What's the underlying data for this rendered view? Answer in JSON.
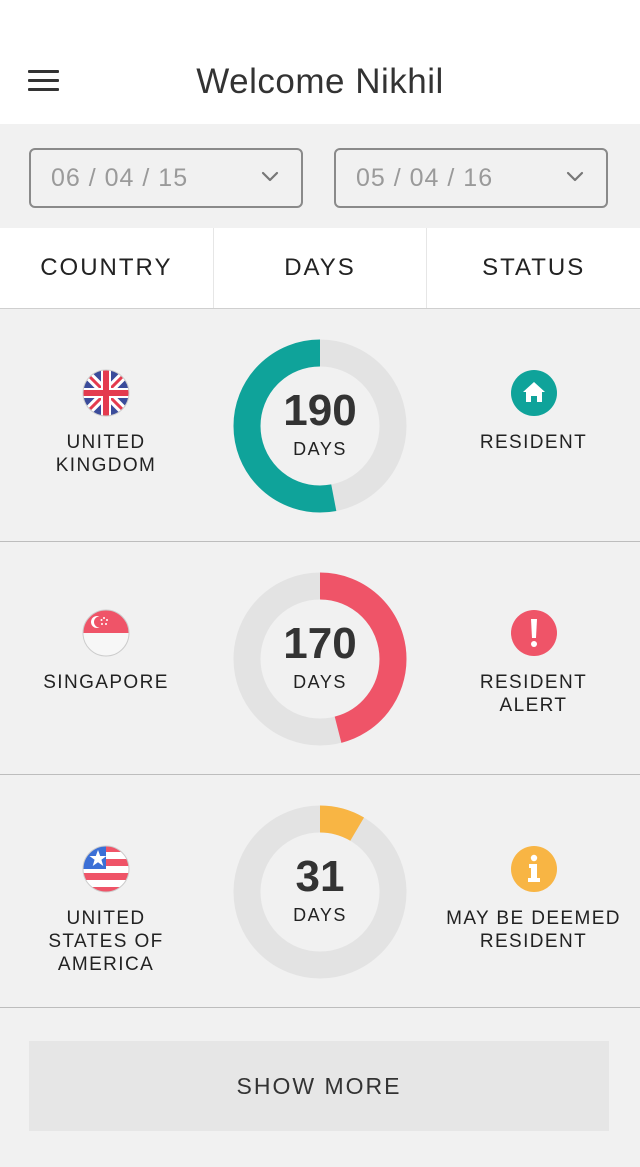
{
  "header": {
    "title": "Welcome Nikhil"
  },
  "date_range": {
    "from": "06 / 04 / 15",
    "to": "05 / 04 / 16"
  },
  "columns": [
    "COUNTRY",
    "DAYS",
    "STATUS"
  ],
  "rows": [
    {
      "country": "UNITED\nKINGDOM",
      "days": "190",
      "days_unit": "DAYS",
      "progress": 0.53,
      "ring_color": "#0fa39a",
      "status": "RESIDENT",
      "status_color": "#0fa39a",
      "status_icon": "home-icon",
      "flag": "uk-flag-icon"
    },
    {
      "country": "SINGAPORE",
      "days": "170",
      "days_unit": "DAYS",
      "progress": 0.46,
      "ring_color": "#ef5468",
      "status": "RESIDENT\nALERT",
      "status_color": "#ef5468",
      "status_icon": "exclamation-icon",
      "flag": "singapore-flag-icon"
    },
    {
      "country": "UNITED\nSTATES OF\nAMERICA",
      "days": "31",
      "days_unit": "DAYS",
      "progress": 0.085,
      "ring_color": "#f8b544",
      "status": "MAY BE DEEMED\nRESIDENT",
      "status_color": "#f8b544",
      "status_icon": "info-icon",
      "flag": "usa-flag-icon"
    }
  ],
  "show_more_label": "SHOW MORE",
  "colors": {
    "background": "#f1f1f1",
    "ring_track": "#e3e3e3"
  }
}
